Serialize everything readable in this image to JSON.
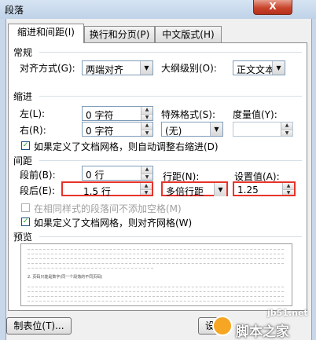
{
  "window": {
    "title": "段落",
    "close_glyph": "X"
  },
  "tabs": [
    {
      "label": "缩进和间距(I)",
      "active": true
    },
    {
      "label": "换行和分页(P)",
      "active": false
    },
    {
      "label": "中文版式(H)",
      "active": false
    }
  ],
  "general": {
    "section": "常规",
    "alignment_label": "对齐方式(G):",
    "alignment_value": "两端对齐",
    "outline_label": "大纲级别(O):",
    "outline_value": "正文文本"
  },
  "indent": {
    "section": "缩进",
    "left_label": "左(L):",
    "left_value": "0 字符",
    "right_label": "右(R):",
    "right_value": "0 字符",
    "special_label": "特殊格式(S):",
    "special_value": "(无)",
    "measure_label": "度量值(Y):",
    "measure_value": "",
    "grid_check_label": "如果定义了文档网格，则自动调整右缩进(D)",
    "grid_checked": true
  },
  "spacing": {
    "section": "间距",
    "before_label": "段前(B):",
    "before_value": "0 行",
    "after_label": "段后(E):",
    "after_value": "1.5 行",
    "line_label": "行距(N):",
    "line_value": "多倍行距",
    "setting_label": "设置值(A):",
    "setting_value": "1.25",
    "no_space_label": "在相同样式的段落间不添加空格(M)",
    "no_space_checked": false,
    "snap_label": "如果定义了文档网格，则对齐网格(W)",
    "snap_checked": true
  },
  "preview": {
    "section": "预览",
    "sample_text": "2. 页码只能是数字(同一个段落的不同页码)"
  },
  "buttons": {
    "tabs_button": "制表位(T)...",
    "default_button": "设"
  },
  "watermark": {
    "site": "jb51.net",
    "name": "脚本之家"
  },
  "icons": {
    "check": "✓",
    "arrow_down": "▼",
    "spin_up": "▲",
    "spin_down": "▼"
  }
}
